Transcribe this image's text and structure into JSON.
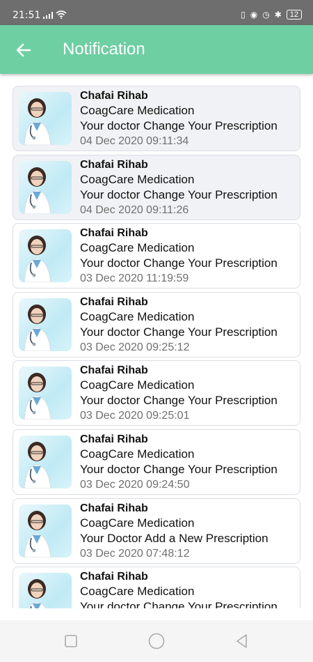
{
  "status_bar": {
    "time": "21:51",
    "battery": "12"
  },
  "app_bar": {
    "title": "Notification"
  },
  "notifications": [
    {
      "sender": "Chafai Rihab",
      "app": "CoagCare Medication",
      "message": "Your doctor Change Your Prescription",
      "date": "04 Dec 2020 09:11:34",
      "read": true
    },
    {
      "sender": "Chafai Rihab",
      "app": "CoagCare Medication",
      "message": "Your doctor Change Your Prescription",
      "date": "04 Dec 2020 09:11:26",
      "read": true
    },
    {
      "sender": "Chafai Rihab",
      "app": "CoagCare Medication",
      "message": "Your doctor Change Your Prescription",
      "date": "03 Dec 2020 11:19:59",
      "read": false
    },
    {
      "sender": "Chafai Rihab",
      "app": "CoagCare Medication",
      "message": "Your doctor Change Your Prescription",
      "date": "03 Dec 2020 09:25:12",
      "read": false
    },
    {
      "sender": "Chafai Rihab",
      "app": "CoagCare Medication",
      "message": "Your doctor Change Your Prescription",
      "date": "03 Dec 2020 09:25:01",
      "read": false
    },
    {
      "sender": "Chafai Rihab",
      "app": "CoagCare Medication",
      "message": "Your doctor Change Your Prescription",
      "date": "03 Dec 2020 09:24:50",
      "read": false
    },
    {
      "sender": "Chafai Rihab",
      "app": "CoagCare Medication",
      "message": "Your Doctor Add a New Prescription",
      "date": "03 Dec 2020 07:48:12",
      "read": false
    },
    {
      "sender": "Chafai Rihab",
      "app": "CoagCare Medication",
      "message": "Your doctor Change Your Prescription",
      "date": "",
      "read": false
    }
  ],
  "colors": {
    "app_bar": "#6dcfa2",
    "status_bar": "#6e6e6e",
    "read_card": "#f1f2f5",
    "date_text": "#6f6f6f"
  },
  "icons": {
    "back": "arrow-left-icon",
    "nav_recent": "square-icon",
    "nav_home": "circle-icon",
    "nav_back": "triangle-left-icon"
  }
}
